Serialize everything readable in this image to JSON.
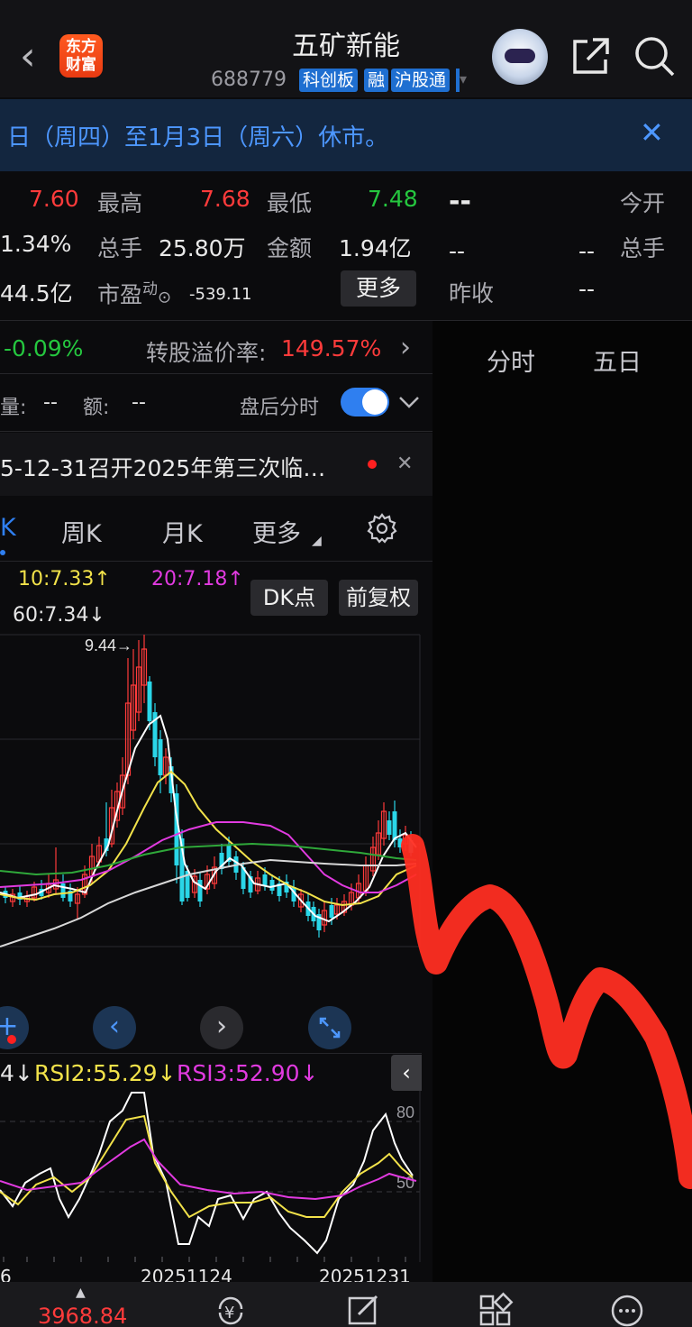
{
  "header": {
    "back": "‹",
    "logo": "东方\n财富",
    "logo_line1": "东方",
    "logo_line2": "财富",
    "title": "五矿新能",
    "code": "688779",
    "tags": [
      "科创板",
      "融",
      "沪股通"
    ]
  },
  "notice": {
    "text": "日（周四）至1月3日（周六）休市。",
    "close": "✕"
  },
  "quote": {
    "row1": {
      "v0": "7.60",
      "l1": "最高",
      "v1": "7.68",
      "l2": "最低",
      "v2": "7.48",
      "r_val": "--",
      "r_lbl": "今开"
    },
    "row2": {
      "v0": "1.34%",
      "l1": "总手",
      "v1": "25.80万",
      "l2": "金额",
      "v2": "1.94亿",
      "r_val1": "--",
      "r_val2": "--",
      "r_lbl": "总手"
    },
    "row3": {
      "v0": "44.5亿",
      "l1": "市盈",
      "l1_sup": "动",
      "v1": "-539.11",
      "more": "更多",
      "r_lbl": "昨收",
      "r_val": "--"
    }
  },
  "bond": {
    "change": "-0.09%",
    "premium_label": "转股溢价率:",
    "premium_value": "149.57%",
    "arrow": "›"
  },
  "right_tabs": [
    "分时",
    "五日"
  ],
  "afterhours": {
    "vol_label": "量:",
    "vol": "--",
    "amt_label": "额:",
    "amt": "--",
    "label": "盘后分时"
  },
  "announcement": {
    "text": "5-12-31召开2025年第三次临…",
    "close": "✕"
  },
  "period_tabs": {
    "k": "K",
    "week": "周K",
    "month": "月K",
    "more": "更多"
  },
  "ma": {
    "ma10": "10:7.33↑",
    "ma20": "20:7.18↑",
    "ma60": "60:7.34↓"
  },
  "chips": {
    "dk": "DK点",
    "adj": "前复权"
  },
  "chart": {
    "high_label": "9.44→"
  },
  "rsi": {
    "rsi1": "4↓",
    "rsi2": "RSI2:55.29↓",
    "rsi3": "RSI3:52.90↓",
    "l80": "80",
    "l50": "50"
  },
  "dates": {
    "d0": "6",
    "d1": "20251124",
    "d2": "20251231"
  },
  "bottom": {
    "index": "3968.84"
  },
  "colors": {
    "up": "#ff3b3b",
    "down": "#25c73f",
    "accent": "#2f7ff0",
    "ma_yellow": "#f2e24a",
    "ma_magenta": "#e13ae0"
  }
}
